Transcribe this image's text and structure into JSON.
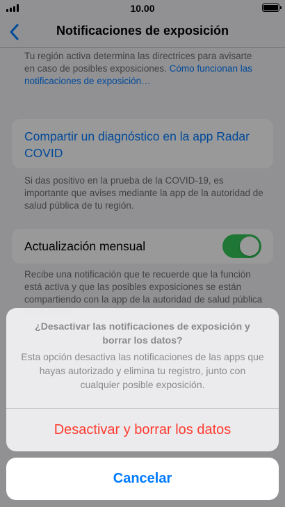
{
  "status_bar": {
    "time": "10.00"
  },
  "nav": {
    "back_icon": "chevron-left-icon",
    "title": "Notificaciones de exposición"
  },
  "sections": {
    "region_note": "Tu región activa determina las directrices para avisarte en caso de posibles exposiciones. ",
    "region_link": "Cómo funcionan las notificaciones de exposición…",
    "share_diagnosis_label": "Compartir un diagnóstico en la app Radar COVID",
    "positive_note": "Si das positivo en la prueba de la COVID-19, es importante que avises mediante la app de la autoridad de salud pública de tu región.",
    "monthly_update_label": "Actualización mensual",
    "monthly_update_on": true,
    "monthly_note": "Recibe una notificación que te recuerde que la función está activa y que las posibles exposiciones se están compartiendo con la app de la autoridad de salud pública de tu región."
  },
  "action_sheet": {
    "title": "¿Desactivar las notificaciones de exposición y borrar los datos?",
    "message": "Esta opción desactiva las notificaciones de las apps que hayas autorizado y elimina tu registro, junto con cualquier posible exposición.",
    "destructive_label": "Desactivar y borrar los datos",
    "cancel_label": "Cancelar"
  },
  "colors": {
    "accent": "#007aff",
    "destructive": "#ff3b30",
    "toggle_on": "#34c759",
    "background": "#f2f2f7"
  }
}
